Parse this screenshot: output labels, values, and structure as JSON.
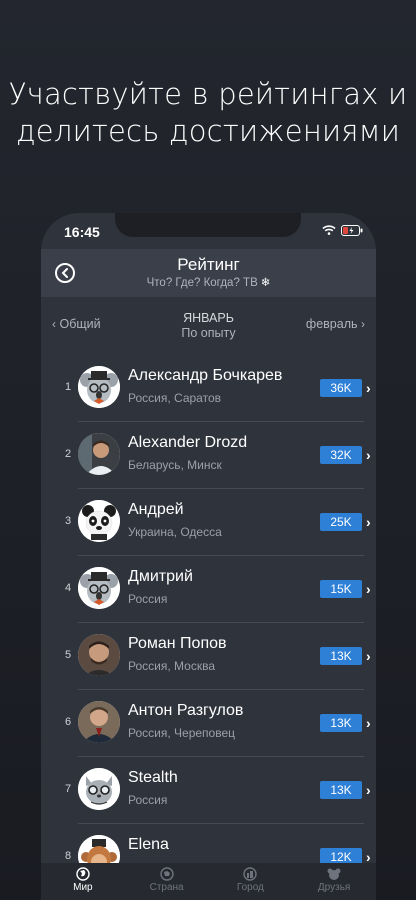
{
  "promo": {
    "line1": "Участвуйте в рейтингах и",
    "line2": "делитесь достижениями"
  },
  "status": {
    "time": "16:45"
  },
  "header": {
    "title": "Рейтинг",
    "subtitle": "Что? Где? Когда? ТВ",
    "back_icon": "back-arrow-circle-icon"
  },
  "period": {
    "prev": "Общий",
    "month": "ЯНВАРЬ",
    "criterion": "По опыту",
    "next": "февраль"
  },
  "rows": [
    {
      "rank": "1",
      "name": "Александр Бочкарев",
      "location": "Россия, Саратов",
      "score": "36K"
    },
    {
      "rank": "2",
      "name": "Alexander  Drozd",
      "location": "Беларусь, Минск",
      "score": "32K"
    },
    {
      "rank": "3",
      "name": "Андрей",
      "location": "Украина, Одесса",
      "score": "25K"
    },
    {
      "rank": "4",
      "name": "Дмитрий",
      "location": "Россия",
      "score": "15K"
    },
    {
      "rank": "5",
      "name": "Роман Попов",
      "location": "Россия, Москва",
      "score": "13K"
    },
    {
      "rank": "6",
      "name": "Антон Разгулов",
      "location": "Россия, Череповец",
      "score": "13K"
    },
    {
      "rank": "7",
      "name": "Stealth",
      "location": "Россия",
      "score": "13K"
    },
    {
      "rank": "8",
      "name": "Elena",
      "location": "",
      "score": "12K"
    }
  ],
  "tabs": [
    {
      "label": "Мир",
      "icon": "globe-icon",
      "active": true
    },
    {
      "label": "Страна",
      "icon": "map-icon",
      "active": false
    },
    {
      "label": "Город",
      "icon": "city-icon",
      "active": false
    },
    {
      "label": "Друзья",
      "icon": "friends-icon",
      "active": false
    }
  ],
  "colors": {
    "accent": "#2e7fd6",
    "background": "#23262e",
    "panel": "#2f333c"
  }
}
